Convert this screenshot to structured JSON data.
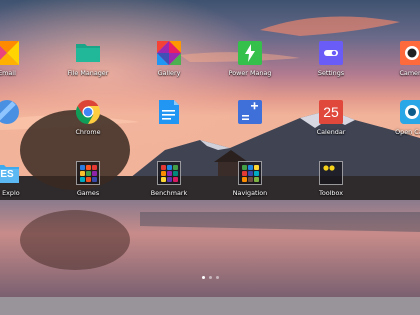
{
  "pager": {
    "count": 3,
    "current": 0
  },
  "apps": [
    {
      "id": "email",
      "label": "Email",
      "icon": "email-icon"
    },
    {
      "id": "file-manager",
      "label": "File Manager",
      "icon": "folder-icon"
    },
    {
      "id": "gallery",
      "label": "Gallery",
      "icon": "gallery-icon"
    },
    {
      "id": "power-manager",
      "label": "Power Manag",
      "icon": "battery-icon"
    },
    {
      "id": "settings",
      "label": "Settings",
      "icon": "settings-icon"
    },
    {
      "id": "camera",
      "label": "Camera",
      "icon": "camera-icon"
    },
    {
      "id": "browser",
      "label": "",
      "icon": "browser-icon"
    },
    {
      "id": "chrome",
      "label": "Chrome",
      "icon": "chrome-icon"
    },
    {
      "id": "docs",
      "label": "",
      "icon": "document-icon"
    },
    {
      "id": "calculator",
      "label": "",
      "icon": "calculator-icon"
    },
    {
      "id": "calendar",
      "label": "Calendar",
      "icon": "calendar-icon",
      "badge": "25"
    },
    {
      "id": "open-camera",
      "label": "Open Cam",
      "icon": "camera-icon"
    },
    {
      "id": "es-explorer",
      "label": "le Explo",
      "icon": "es-file-explorer-icon",
      "badge": "ES"
    },
    {
      "id": "games",
      "label": "Games",
      "icon": "folder-icon"
    },
    {
      "id": "benchmark",
      "label": "Benchmark",
      "icon": "folder-icon"
    },
    {
      "id": "navigation",
      "label": "Navigation",
      "icon": "folder-icon"
    },
    {
      "id": "toolbox",
      "label": "Toolbox",
      "icon": "folder-icon"
    }
  ]
}
